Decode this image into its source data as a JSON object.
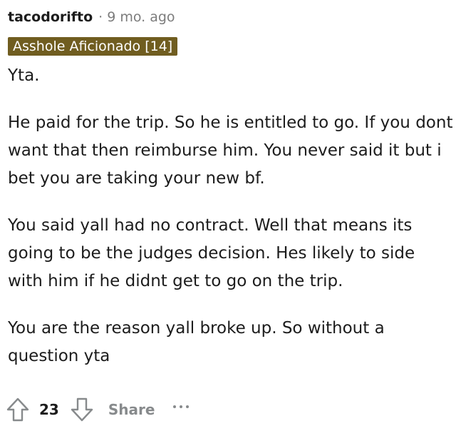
{
  "comment": {
    "author": "tacodorifto",
    "separator": "·",
    "time": "9 mo. ago",
    "flair": "Asshole Aficionado [14]",
    "flair_color": "#705d20",
    "paragraphs": [
      "Yta.",
      "He paid for the trip. So he is entitled to go. If you dont want that then reimburse him. You never said it but i bet you are taking your new bf.",
      "You said yall had no contract. Well that means its going to be the judges decision. Hes likely to side with him if he didnt get to go on the trip.",
      "You are the reason yall broke up. So without a question yta"
    ]
  },
  "actions": {
    "upvote_icon": "upvote-arrow-icon",
    "score": "23",
    "downvote_icon": "downvote-arrow-icon",
    "share_label": "Share",
    "more_icon": "more-options-icon"
  }
}
